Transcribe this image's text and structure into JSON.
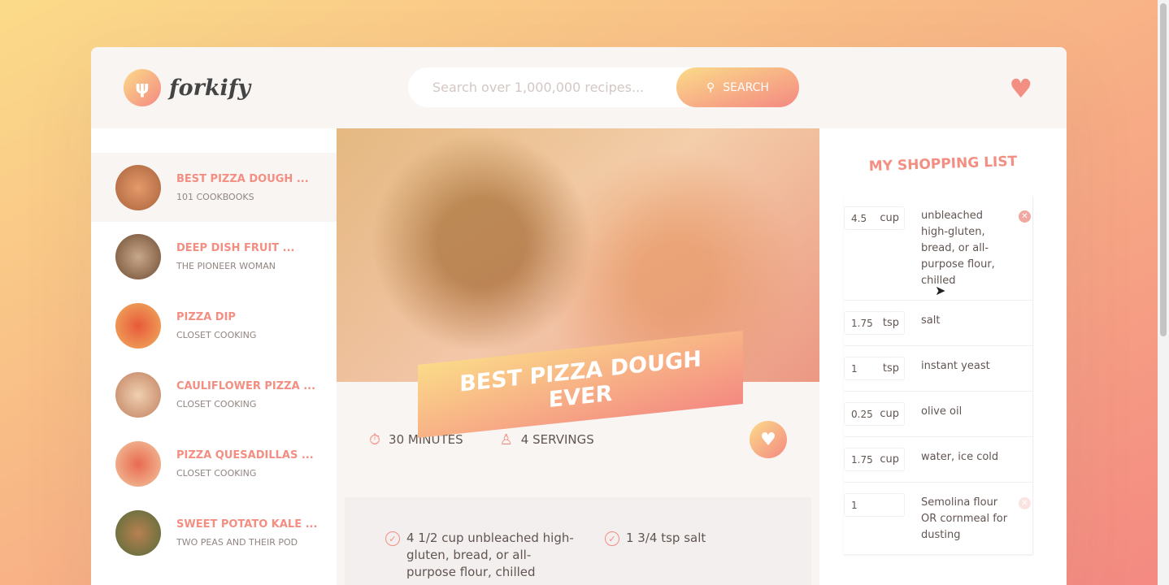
{
  "header": {
    "logo_text": "forkify",
    "search_placeholder": "Search over 1,000,000 recipes...",
    "search_label": "Search"
  },
  "results": [
    {
      "title": "Best Pizza Dough ...",
      "publisher": "101 Cookbooks",
      "active": true
    },
    {
      "title": "Deep Dish Fruit ...",
      "publisher": "The Pioneer Woman"
    },
    {
      "title": "Pizza Dip",
      "publisher": "Closet Cooking"
    },
    {
      "title": "Cauliflower Pizza ...",
      "publisher": "Closet Cooking"
    },
    {
      "title": "Pizza Quesadillas ...",
      "publisher": "Closet Cooking"
    },
    {
      "title": "Sweet Potato Kale ...",
      "publisher": "Two Peas and Their Pod"
    }
  ],
  "recipe": {
    "title": "Best Pizza Dough Ever",
    "time": "30 minutes",
    "servings": "4 servings",
    "ingredients": [
      "4 1/2 cup unbleached high-gluten, bread, or all-purpose flour, chilled",
      "1 3/4 tsp salt"
    ]
  },
  "shopping": {
    "title": "My Shopping List",
    "items": [
      {
        "count": "4.5",
        "unit": "cup",
        "desc": "unbleached high-gluten, bread, or all-purpose flour, chilled"
      },
      {
        "count": "1.75",
        "unit": "tsp",
        "desc": "salt"
      },
      {
        "count": "1",
        "unit": "tsp",
        "desc": "instant yeast"
      },
      {
        "count": "0.25",
        "unit": "cup",
        "desc": "olive oil"
      },
      {
        "count": "1.75",
        "unit": "cup",
        "desc": "water, ice cold"
      },
      {
        "count": "1",
        "unit": "",
        "desc": "Semolina flour OR cornmeal for dusting"
      }
    ]
  },
  "colors": {
    "accent": "#f38e82",
    "gradient_start": "#fbdb89",
    "gradient_end": "#f48982"
  }
}
